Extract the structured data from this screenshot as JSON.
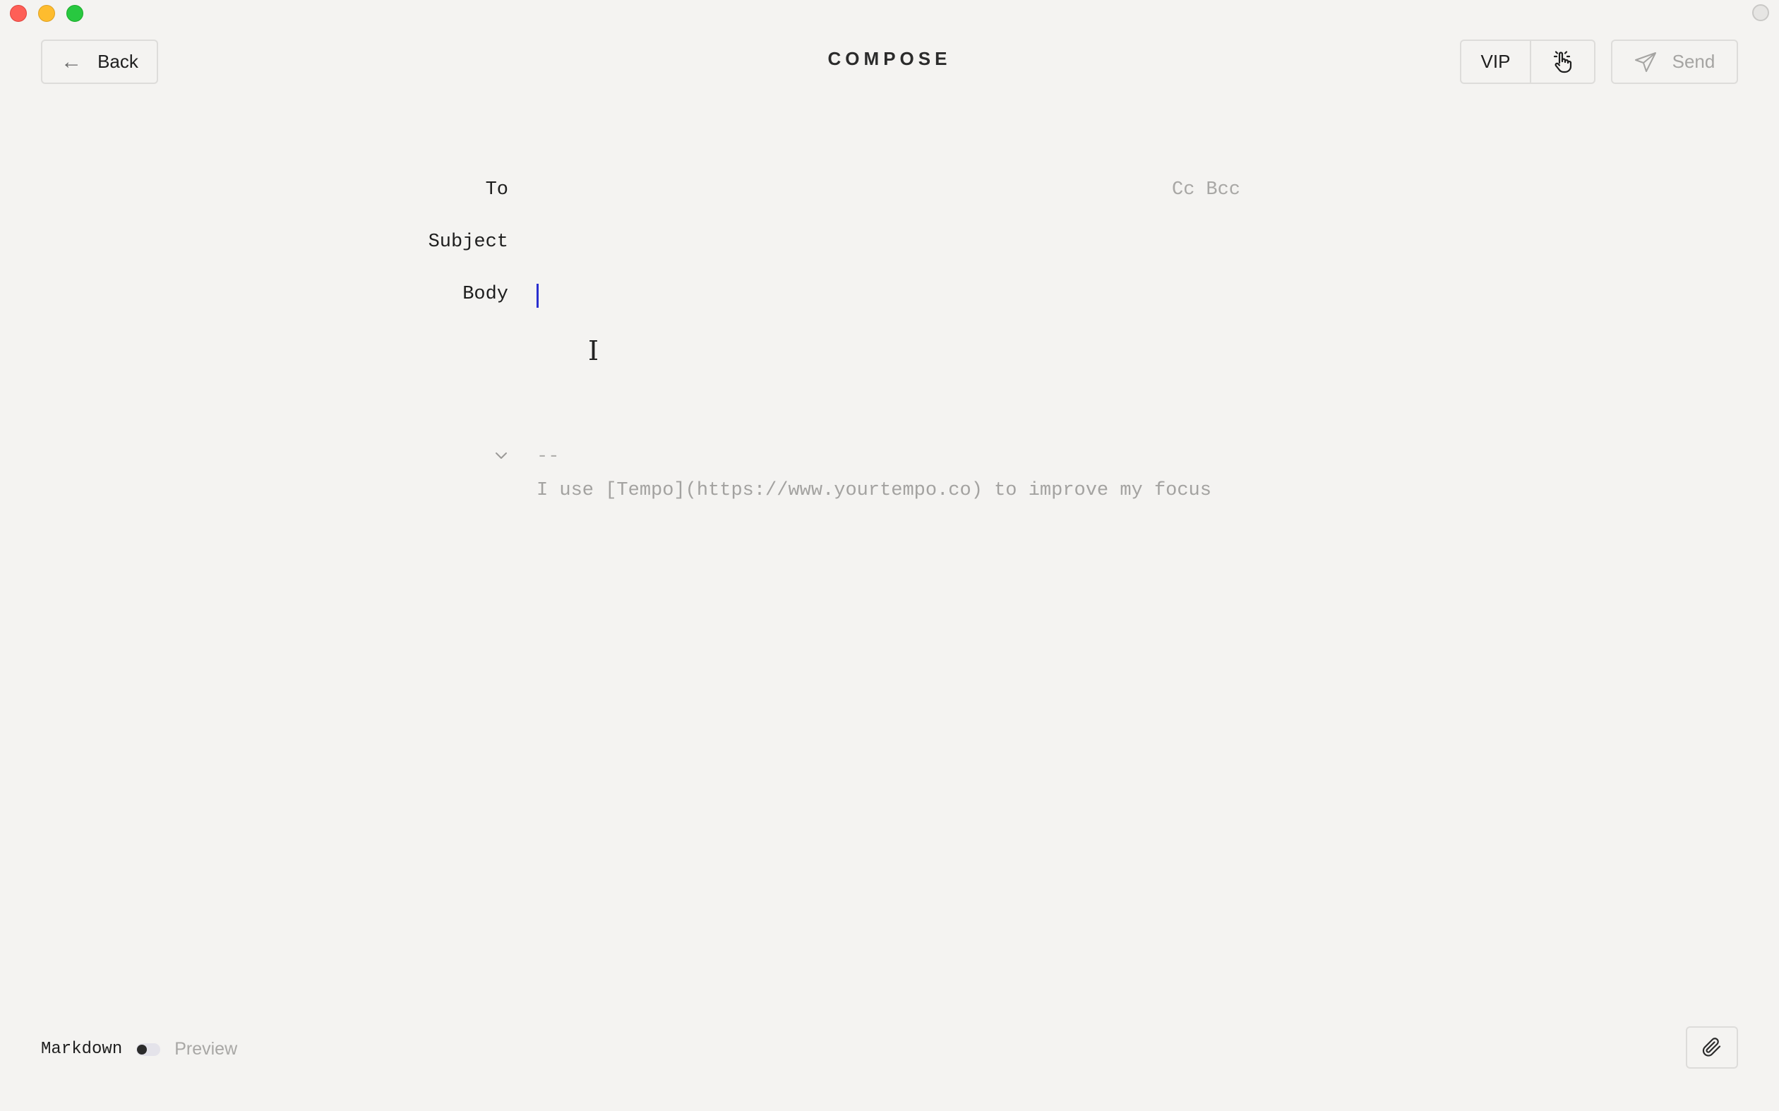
{
  "window": {
    "title": "COMPOSE"
  },
  "toolbar": {
    "back_label": "Back",
    "vip_label": "VIP",
    "send_label": "Send"
  },
  "form": {
    "to_label": "To",
    "cc_label": "Cc",
    "bcc_label": "Bcc",
    "subject_label": "Subject",
    "body_label": "Body"
  },
  "signature": {
    "separator": "--",
    "text": "I use [Tempo](https://www.yourtempo.co) to improve my focus"
  },
  "footer": {
    "markdown_label": "Markdown",
    "preview_label": "Preview",
    "preview_enabled": false
  },
  "colors": {
    "background": "#f4f3f1",
    "caret": "#2a2fcf",
    "muted_text": "#a8a7a5",
    "border": "#dddcda"
  },
  "icons": {
    "back": "arrow-left-icon",
    "handoff": "hand-pointer-icon",
    "send": "paper-plane-icon",
    "collapse": "chevron-down-icon",
    "attach": "paperclip-icon"
  }
}
